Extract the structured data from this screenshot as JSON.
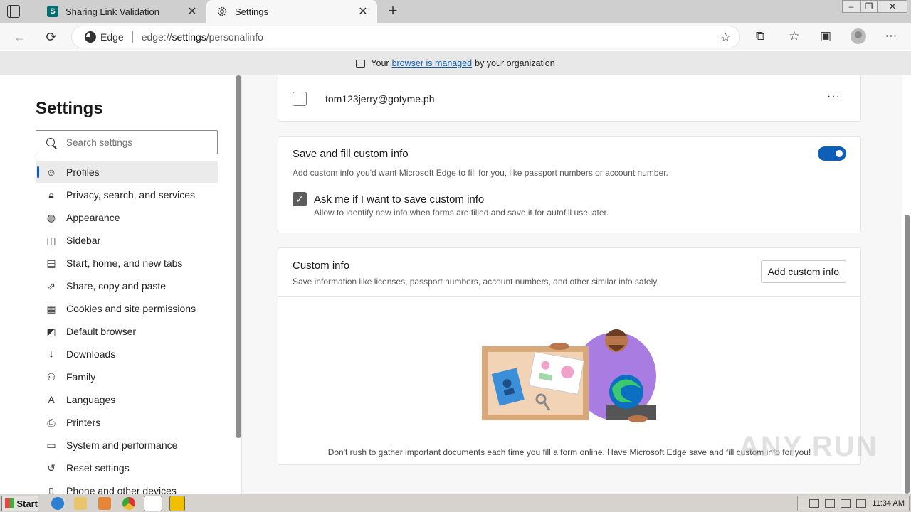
{
  "browser": {
    "tabs": [
      {
        "title": "Sharing Link Validation",
        "favicon": "sharepoint-icon",
        "active": false
      },
      {
        "title": "Settings",
        "favicon": "gear-icon",
        "active": true
      }
    ],
    "close_glyph": "✕",
    "new_tab_glyph": "+",
    "omnibox": {
      "brand": "Edge",
      "url_prefix": "edge://",
      "url_bold": "settings",
      "url_suffix": "/personalinfo"
    },
    "managed_banner": {
      "before": "Your",
      "link": "browser is managed",
      "after": "by your organization"
    }
  },
  "sidebar": {
    "title": "Settings",
    "search_placeholder": "Search settings",
    "items": [
      {
        "label": "Profiles",
        "icon": "profile-icon",
        "active": true
      },
      {
        "label": "Privacy, search, and services",
        "icon": "lock-icon"
      },
      {
        "label": "Appearance",
        "icon": "palette-icon"
      },
      {
        "label": "Sidebar",
        "icon": "sidebar-icon"
      },
      {
        "label": "Start, home, and new tabs",
        "icon": "home-icon"
      },
      {
        "label": "Share, copy and paste",
        "icon": "share-icon"
      },
      {
        "label": "Cookies and site permissions",
        "icon": "cookie-icon"
      },
      {
        "label": "Default browser",
        "icon": "browser-icon"
      },
      {
        "label": "Downloads",
        "icon": "download-icon"
      },
      {
        "label": "Family",
        "icon": "family-icon"
      },
      {
        "label": "Languages",
        "icon": "language-icon"
      },
      {
        "label": "Printers",
        "icon": "printer-icon"
      },
      {
        "label": "System and performance",
        "icon": "laptop-icon"
      },
      {
        "label": "Reset settings",
        "icon": "reset-icon"
      },
      {
        "label": "Phone and other devices",
        "icon": "phone-icon"
      }
    ]
  },
  "main": {
    "email_entry": {
      "email": "tom123jerry@gotyme.ph",
      "more": "···"
    },
    "save_fill": {
      "title": "Save and fill custom info",
      "description": "Add custom info you'd want Microsoft Edge to fill for you, like passport numbers or account number.",
      "toggle_on": true,
      "ask_title": "Ask me if I want to save custom info",
      "ask_description": "Allow to identify new info when forms are filled and save it for autofill use later.",
      "ask_checked": true
    },
    "custom_info": {
      "title": "Custom info",
      "description": "Save information like licenses, passport numbers, account numbers, and other similar info safely.",
      "add_button": "Add custom info",
      "empty_message": "Don't rush to gather important documents each time you fill a form online. Have Microsoft Edge save and fill custom info for you!"
    }
  },
  "watermark": "ANY RUN",
  "taskbar": {
    "start_label": "Start",
    "clock": "11:34 AM"
  }
}
